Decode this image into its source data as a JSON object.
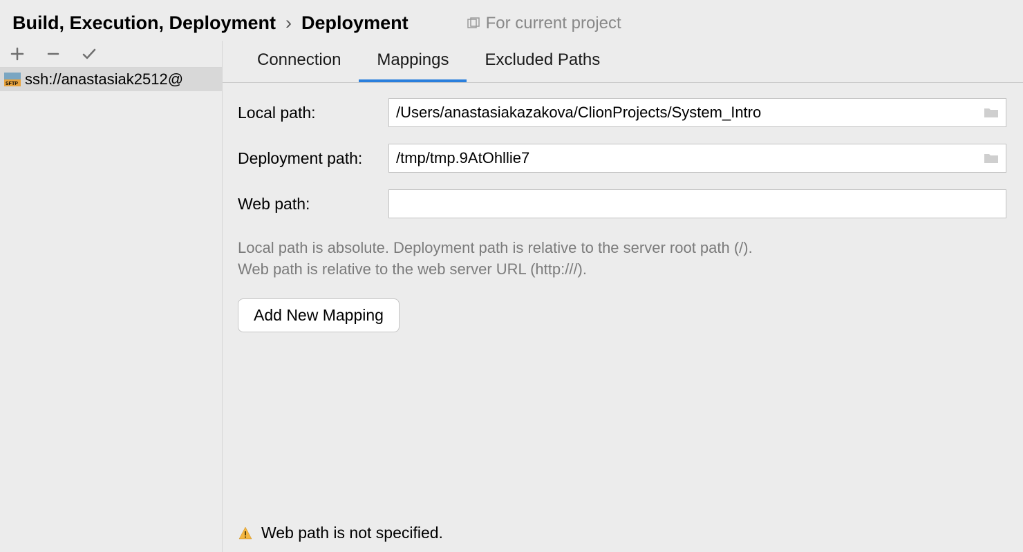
{
  "breadcrumb": {
    "parent": "Build, Execution, Deployment",
    "current": "Deployment"
  },
  "scope": {
    "label": "For current project"
  },
  "toolbar": {
    "add": "add",
    "remove": "remove",
    "default": "set-default"
  },
  "servers": [
    {
      "icon": "sftp",
      "label": "ssh://anastasiak2512@"
    }
  ],
  "tabs": [
    {
      "id": "connection",
      "label": "Connection",
      "active": false
    },
    {
      "id": "mappings",
      "label": "Mappings",
      "active": true
    },
    {
      "id": "excluded",
      "label": "Excluded Paths",
      "active": false
    }
  ],
  "form": {
    "localPathLabel": "Local path:",
    "localPathValue": "/Users/anastasiakazakova/ClionProjects/System_Intro",
    "deploymentPathLabel": "Deployment path:",
    "deploymentPathValue": "/tmp/tmp.9AtOhllie7",
    "webPathLabel": "Web path:",
    "webPathValue": "",
    "hintLine1": "Local path is absolute. Deployment path is relative to the server root path (/).",
    "hintLine2": "Web path is relative to the web server URL (http:///).",
    "addMappingLabel": "Add New Mapping"
  },
  "warning": {
    "text": "Web path is not specified."
  }
}
